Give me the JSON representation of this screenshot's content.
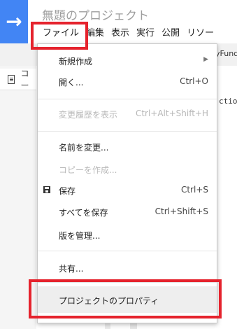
{
  "header": {
    "title": "無題のプロジェクト",
    "logo_glyph": "→",
    "accent_color": "#4285f4"
  },
  "menubar": {
    "items": [
      "ファイル",
      "編集",
      "表示",
      "実行",
      "公開",
      "リソー"
    ]
  },
  "toolbar": {
    "function_text": "yFunc"
  },
  "left_panel": {
    "file_label": "コー"
  },
  "editor": {
    "code_fragment": "ctio"
  },
  "file_menu": {
    "items": [
      {
        "label": "新規作成",
        "shortcut": "",
        "submenu": true,
        "disabled": false
      },
      {
        "label": "開く...",
        "shortcut": "Ctrl+O",
        "disabled": false
      },
      {
        "label": "変更履歴を表示",
        "shortcut": "Ctrl+Alt+Shift+H",
        "disabled": true
      },
      {
        "label": "名前を変更...",
        "shortcut": "",
        "disabled": false
      },
      {
        "label": "コピーを作成...",
        "shortcut": "",
        "disabled": true
      },
      {
        "label": "保存",
        "shortcut": "Ctrl+S",
        "icon": "save-icon",
        "disabled": false
      },
      {
        "label": "すべてを保存",
        "shortcut": "Ctrl+Shift+S",
        "disabled": false
      },
      {
        "label": "版を管理...",
        "shortcut": "",
        "disabled": false
      },
      {
        "label": "共有...",
        "shortcut": "",
        "disabled": false
      },
      {
        "label": "プロジェクトのプロパティ",
        "shortcut": "",
        "disabled": false,
        "highlighted": true
      }
    ]
  },
  "highlight_color": "#e5232d"
}
